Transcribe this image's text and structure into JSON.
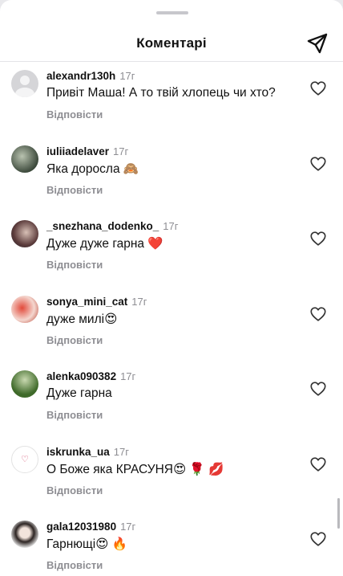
{
  "header": {
    "title": "Коментарі"
  },
  "reply_label": "Відповісти",
  "comments": [
    {
      "username": "alexandr130h",
      "time": "17г",
      "text": "Привіт Маша! А то твій хлопець чи хто?"
    },
    {
      "username": "iuliiadelaver",
      "time": "17г",
      "text": "Яка доросла 🙈"
    },
    {
      "username": "_snezhana_dodenko_",
      "time": "17г",
      "text": "Дуже дуже гарна ❤️"
    },
    {
      "username": "sonya_mini_cat",
      "time": "17г",
      "text": "дуже милі😍"
    },
    {
      "username": "alenka090382",
      "time": "17г",
      "text": "Дуже гарна"
    },
    {
      "username": "iskrunka_ua",
      "time": "17г",
      "text": "О Боже яка КРАСУНЯ😍 🌹 💋"
    },
    {
      "username": "gala12031980",
      "time": "17г",
      "text": "Гарнющі😍 🔥"
    }
  ]
}
